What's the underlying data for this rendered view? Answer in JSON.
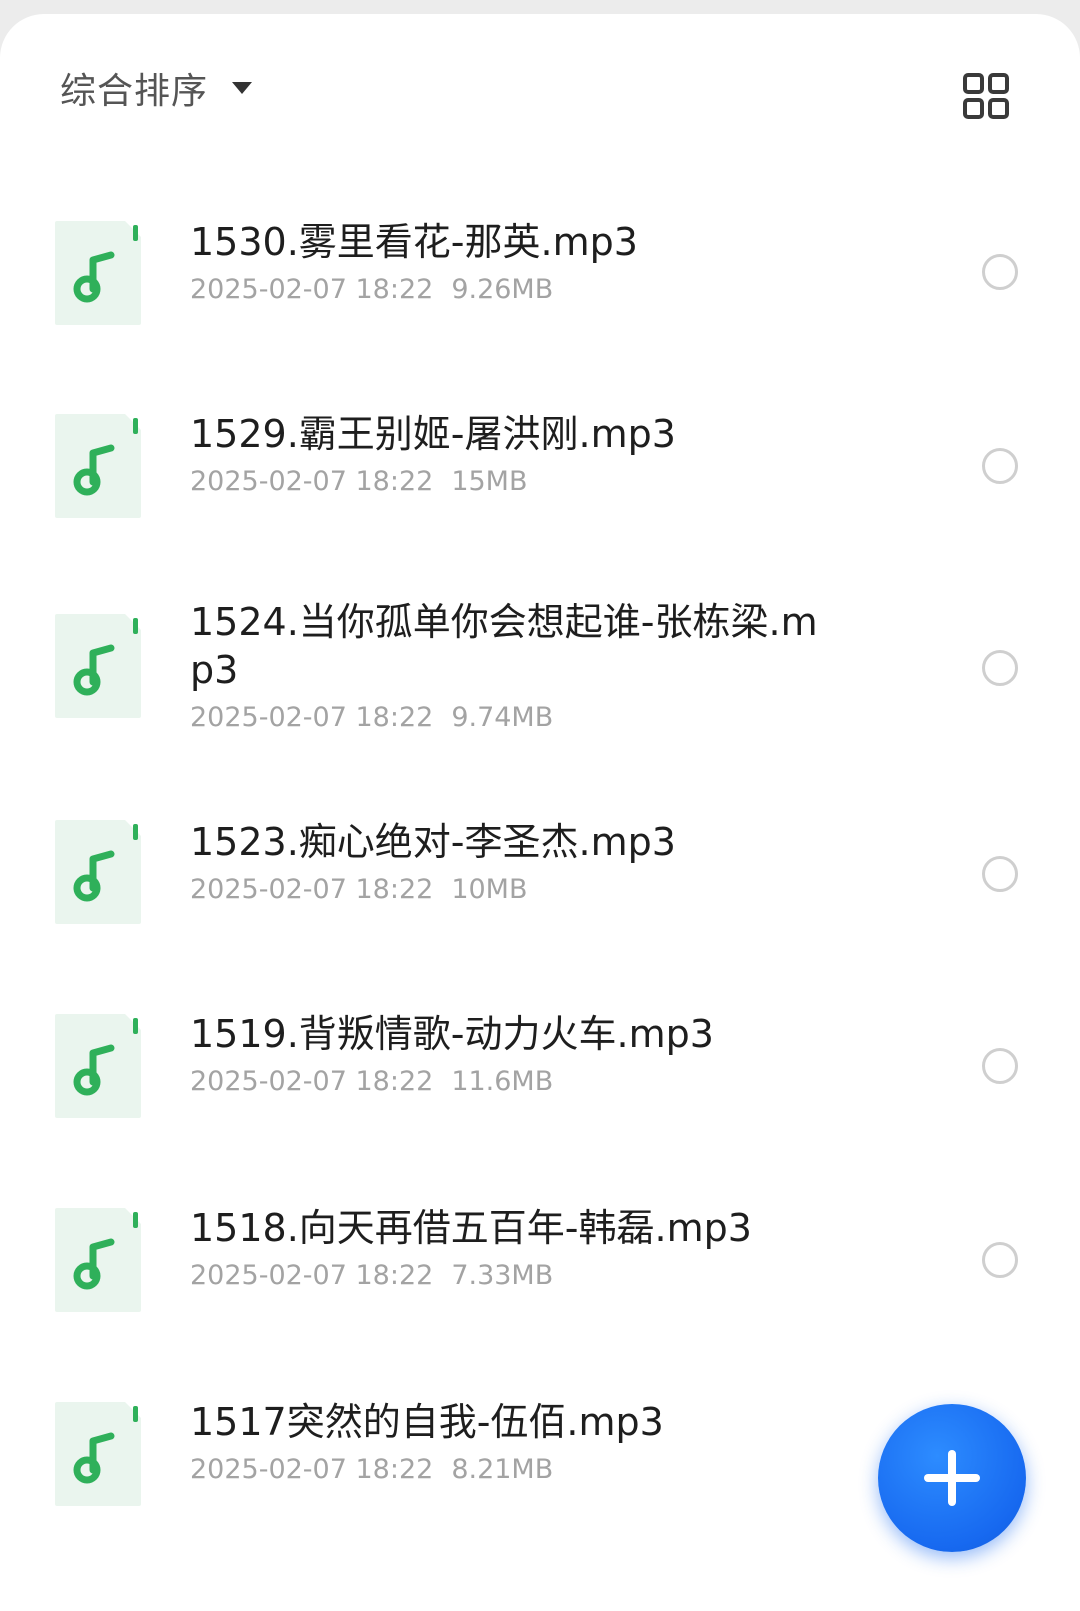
{
  "toolbar": {
    "sort_label": "综合排序",
    "sort_icon": "caret-down-icon",
    "view_toggle_icon": "grid-view-icon"
  },
  "theme": {
    "accent": "#1769f0",
    "music_icon_color": "#2fb05a",
    "file_icon_bg": "#eaf5ee"
  },
  "files": [
    {
      "name": "1530.雾里看花-那英.mp3",
      "date": "2025-02-07 18:22",
      "size": "9.26MB",
      "icon": "music-file-icon",
      "selected": false
    },
    {
      "name": "1529.霸王别姬-屠洪刚.mp3",
      "date": "2025-02-07 18:22",
      "size": "15MB",
      "icon": "music-file-icon",
      "selected": false
    },
    {
      "name": "1524.当你孤单你会想起谁-张栋梁.mp3",
      "date": "2025-02-07 18:22",
      "size": "9.74MB",
      "icon": "music-file-icon",
      "selected": false
    },
    {
      "name": "1523.痴心绝对-李圣杰.mp3",
      "date": "2025-02-07 18:22",
      "size": "10MB",
      "icon": "music-file-icon",
      "selected": false
    },
    {
      "name": "1519.背叛情歌-动力火车.mp3",
      "date": "2025-02-07 18:22",
      "size": "11.6MB",
      "icon": "music-file-icon",
      "selected": false
    },
    {
      "name": "1518.向天再借五百年-韩磊.mp3",
      "date": "2025-02-07 18:22",
      "size": "7.33MB",
      "icon": "music-file-icon",
      "selected": false
    },
    {
      "name": "1517突然的自我-伍佰.mp3",
      "date": "2025-02-07 18:22",
      "size": "8.21MB",
      "icon": "music-file-icon",
      "selected": false
    }
  ],
  "fab": {
    "icon": "plus-icon"
  }
}
